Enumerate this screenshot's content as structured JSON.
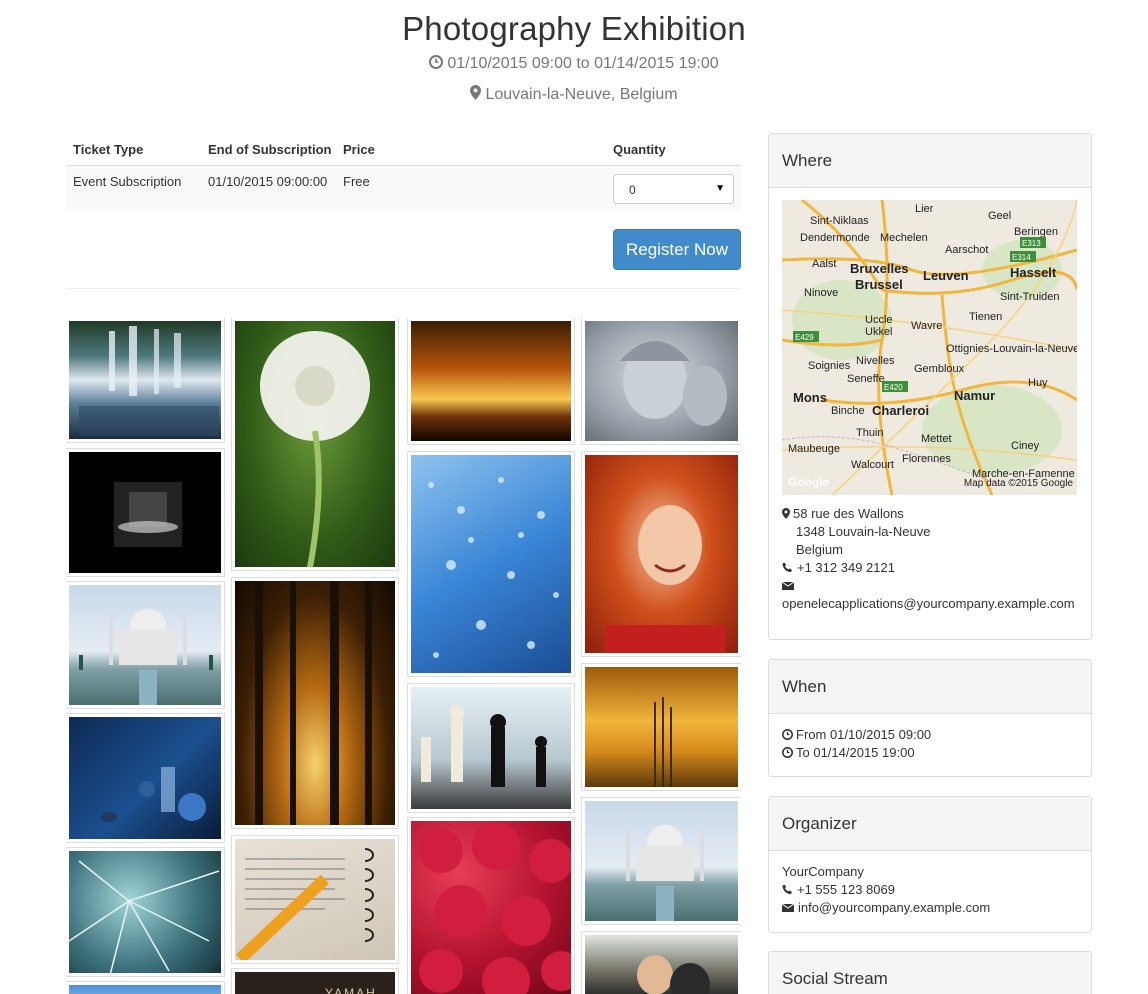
{
  "event": {
    "title": "Photography Exhibition",
    "dates": "01/10/2015 09:00 to 01/14/2015 19:00",
    "location": "Louvain-la-Neuve, Belgium"
  },
  "tickets": {
    "headers": [
      "Ticket Type",
      "End of Subscription",
      "Price",
      "Quantity"
    ],
    "rows": [
      {
        "type": "Event Subscription",
        "end": "01/10/2015 09:00:00",
        "price": "Free",
        "quantity": "0"
      }
    ],
    "register_label": "Register Now"
  },
  "gallery": {
    "images": [
      "waterfall",
      "dandelion",
      "sunset-clouds",
      "angel-statue",
      "dark-corridor",
      "water-drops",
      "red-haired-woman",
      "taj-mahal",
      "forest-sunlight",
      "chess",
      "wheat-sunset",
      "blue-clocks",
      "dictionary-pencil",
      "raspberries",
      "taj-mahal-2",
      "cracked-glass",
      "couple"
    ],
    "partial_caption": "YAMAH"
  },
  "where": {
    "heading": "Where",
    "map_credit": "Map data ©2015 Google",
    "map_logo": "Google",
    "map_labels": [
      "Sint-Niklaas",
      "Lier",
      "Geel",
      "Dendermonde",
      "Mechelen",
      "Beringen",
      "Aarschot",
      "Aalst",
      "Bruxelles",
      "Brussel",
      "Leuven",
      "Hasselt",
      "Ninove",
      "Sint-Truiden",
      "Uccle",
      "Ukkel",
      "Tienen",
      "Wavre",
      "Ottignies-Louvain-la-Neuve",
      "Soignies",
      "Nivelles",
      "Seneffe",
      "Gembloux",
      "Huy",
      "Mons",
      "Binche",
      "Charleroi",
      "Namur",
      "Thuin",
      "Mettet",
      "Maubeuge",
      "Florennes",
      "Ciney",
      "Walcourt",
      "Marche-en-Famenne",
      "E313",
      "E314",
      "E429",
      "E420"
    ],
    "address_line1": "58 rue des Wallons",
    "address_line2": "1348 Louvain-la-Neuve",
    "address_line3": "Belgium",
    "phone": "+1 312 349 2121",
    "email": "openelecapplications@yourcompany.example.com"
  },
  "when": {
    "heading": "When",
    "from": "From 01/10/2015 09:00",
    "to": "To 01/14/2015 19:00"
  },
  "organizer": {
    "heading": "Organizer",
    "name": "YourCompany",
    "phone": "+1 555 123 8069",
    "email": "info@yourcompany.example.com"
  },
  "social": {
    "heading": "Social Stream"
  },
  "colors": {
    "primary": "#428bca",
    "muted": "#777777",
    "panel_head": "#f5f5f5"
  }
}
